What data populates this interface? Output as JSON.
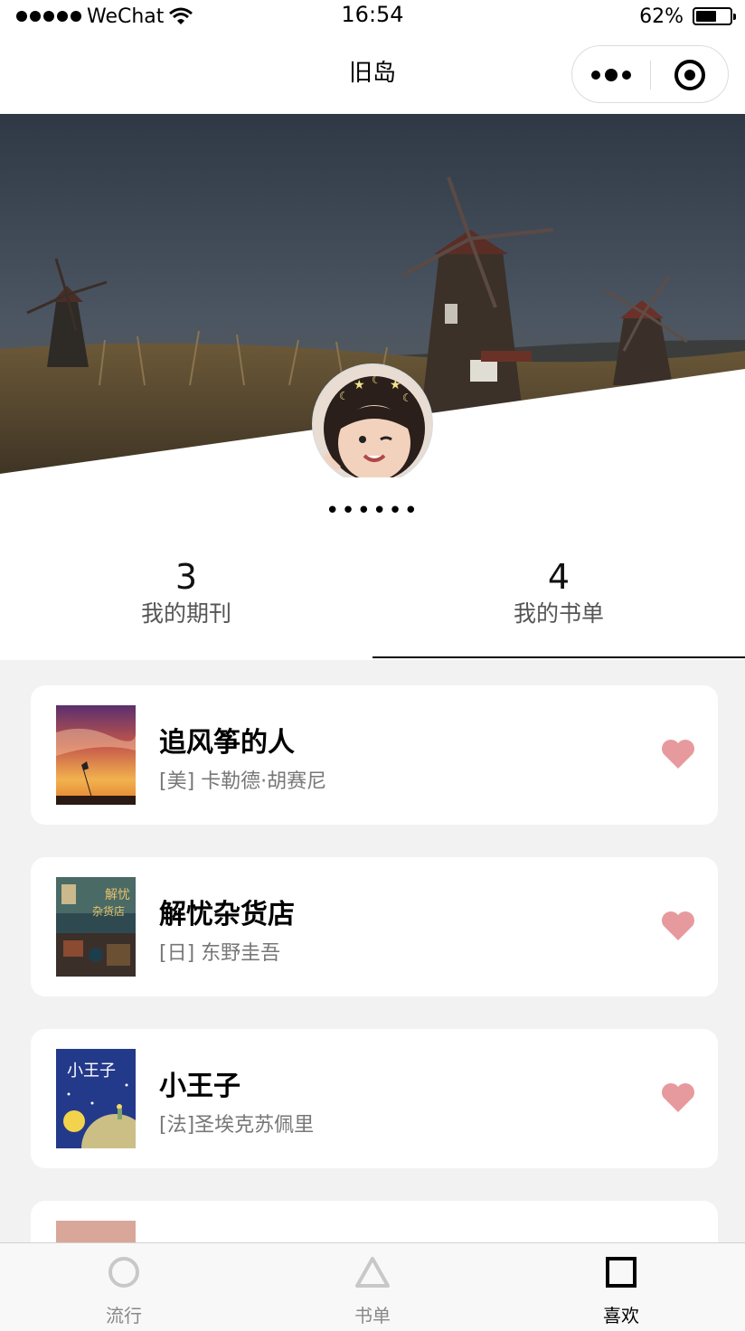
{
  "status_bar": {
    "carrier": "WeChat",
    "time": "16:54",
    "battery_text": "62%",
    "battery_level": 0.62
  },
  "nav": {
    "title": "旧岛"
  },
  "profile": {
    "nickname": "••••••"
  },
  "stats": [
    {
      "count": "3",
      "label": "我的期刊"
    },
    {
      "count": "4",
      "label": "我的书单"
    }
  ],
  "active_stat_tab": 1,
  "books": [
    {
      "title": "追风筝的人",
      "author": "[美] 卡勒德·胡赛尼",
      "cover_icon": "kite-runner-cover"
    },
    {
      "title": "解忧杂货店",
      "author": "[日] 东野圭吾",
      "cover_icon": "namiya-cover",
      "cover_text_a": "解忧",
      "cover_text_b": "杂货店"
    },
    {
      "title": "小王子",
      "author": "[法]圣埃克苏佩里",
      "cover_icon": "little-prince-cover",
      "cover_text": "小王子"
    },
    {
      "title": "",
      "author": "",
      "cover_icon": "partial-cover"
    }
  ],
  "tabs": [
    {
      "label": "流行",
      "icon": "circle-icon"
    },
    {
      "label": "书单",
      "icon": "triangle-icon"
    },
    {
      "label": "喜欢",
      "icon": "square-icon"
    }
  ],
  "active_tab": 2,
  "colors": {
    "heart": "#e79a9d",
    "active": "#000000",
    "inactive": "#888888",
    "background": "#f2f2f2"
  }
}
